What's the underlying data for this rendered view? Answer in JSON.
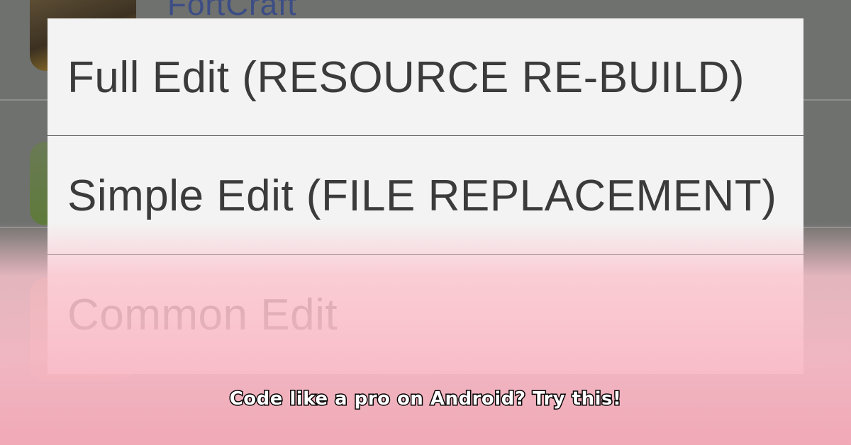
{
  "background": {
    "app_title": "FortCraft"
  },
  "menu": {
    "items": [
      {
        "label": "Full Edit (RESOURCE RE-BUILD)"
      },
      {
        "label": "Simple Edit (FILE REPLACEMENT)"
      },
      {
        "label": "Common Edit"
      }
    ]
  },
  "caption": "Code like a pro on Android?  Try this!",
  "colors": {
    "overlay_dim": "#6f716e",
    "dialog_background": "#f3f3f3",
    "menu_text": "#3b3b3b",
    "app_title_text": "#3c4d86",
    "pink_fade": "#f4aab8",
    "caption_text": "#ffffff",
    "caption_outline": "#000000"
  },
  "icons": {
    "app_icons": [
      "game-app-icon",
      "green-app-icon",
      "character-app-icon"
    ]
  }
}
